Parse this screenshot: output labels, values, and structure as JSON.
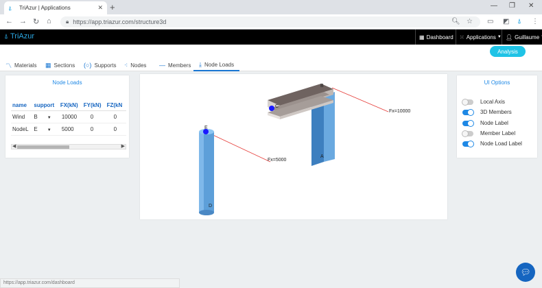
{
  "browser": {
    "tab_title": "TriAzur | Applications",
    "url_base": "https://app.triazur.com",
    "url_path": "/structure3d",
    "status_url": "https://app.triazur.com/dashboard"
  },
  "app": {
    "brand": "TriAzur",
    "nav": {
      "dashboard": "Dashboard",
      "applications": "Applications",
      "user": "Guillaume"
    },
    "analysis_button": "Analysis"
  },
  "tabs": [
    {
      "label": "Materials",
      "icon": "chart-line-icon"
    },
    {
      "label": "Sections",
      "icon": "grid-icon"
    },
    {
      "label": "Supports",
      "icon": "support-icon"
    },
    {
      "label": "Nodes",
      "icon": "nodes-icon"
    },
    {
      "label": "Members",
      "icon": "minus-icon"
    },
    {
      "label": "Node Loads",
      "icon": "download-icon",
      "active": true
    }
  ],
  "node_loads": {
    "title": "Node Loads",
    "columns": [
      "name",
      "support",
      "FX(kN)",
      "FY(kN)",
      "FZ(kN"
    ],
    "rows": [
      {
        "name": "Wind",
        "support": "B",
        "fx": "10000",
        "fy": "0",
        "fz": "0"
      },
      {
        "name": "NodeL",
        "support": "E",
        "fx": "5000",
        "fy": "0",
        "fz": "0"
      }
    ]
  },
  "scene": {
    "labels": {
      "b": "B",
      "a": "A",
      "e": "E",
      "d": "D",
      "c": "C"
    },
    "load_labels": [
      "Fx=10000",
      "Fx=5000"
    ],
    "colors": {
      "member": "#5d9fd9",
      "load": "#e53935",
      "node": "#1a1aff"
    }
  },
  "ui_options": {
    "title": "UI Options",
    "items": [
      {
        "label": "Local Axis",
        "on": false
      },
      {
        "label": "3D Members",
        "on": true
      },
      {
        "label": "Node Label",
        "on": true
      },
      {
        "label": "Member Label",
        "on": false
      },
      {
        "label": "Node Load Label",
        "on": true
      }
    ]
  }
}
